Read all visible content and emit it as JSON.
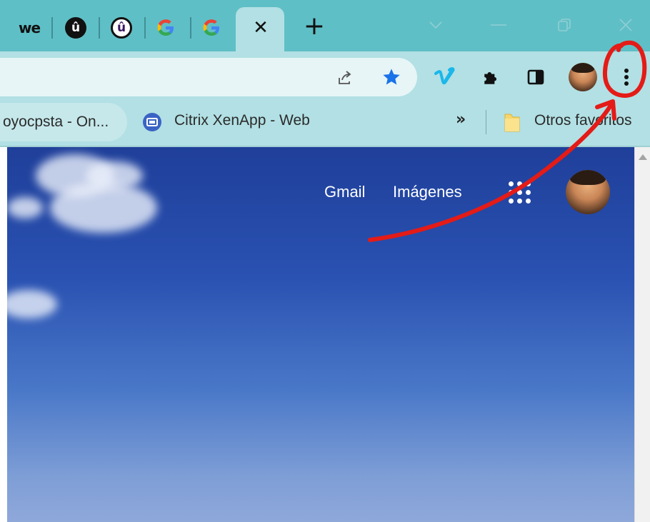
{
  "tabs": {
    "items": [
      {
        "icon": "wetransfer-logo-icon",
        "label": "we"
      },
      {
        "icon": "u-logo-dark-icon",
        "label": "û"
      },
      {
        "icon": "u-logo-light-icon",
        "label": "û"
      },
      {
        "icon": "google-logo-icon",
        "label": "G"
      },
      {
        "icon": "google-logo-icon",
        "label": "G"
      }
    ],
    "close_glyph": "✕",
    "new_tab_glyph": "+"
  },
  "bookmarks": {
    "item1": "oyocpsta - On...",
    "item2": "Citrix XenApp - Web",
    "more": "»",
    "folder": "Otros favoritos"
  },
  "google_header": {
    "gmail": "Gmail",
    "images": "Imágenes"
  },
  "colors": {
    "tabstrip": "#5fbfc6",
    "toolbar": "#b2e0e4",
    "star": "#1a73e8",
    "vimeo": "#1ab7ea",
    "annotation": "#e41b17"
  }
}
